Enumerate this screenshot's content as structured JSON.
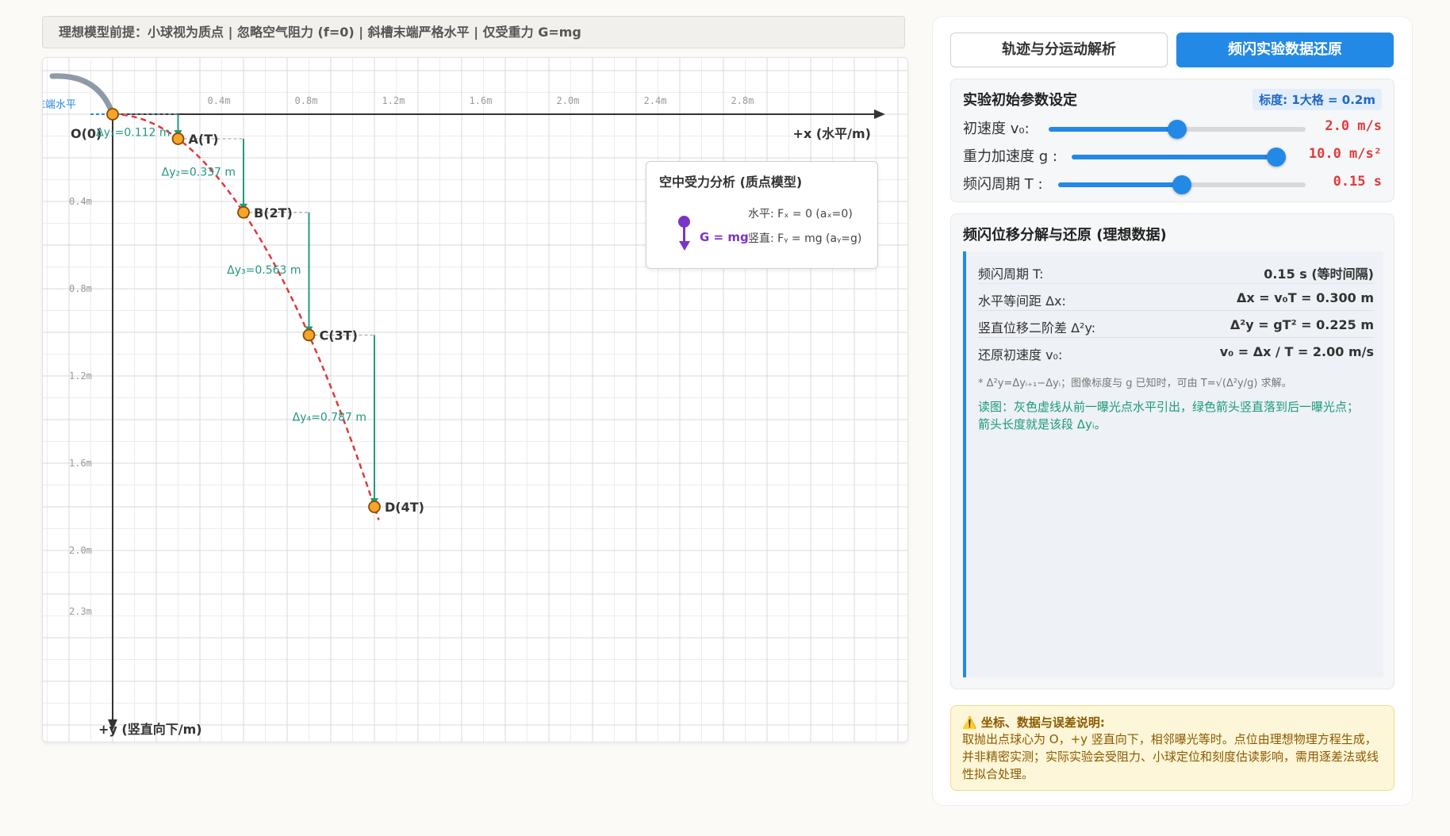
{
  "assumption": "理想模型前提：小球视为质点 | 忽略空气阻力 (f=0) | 斜槽末端严格水平 | 仅受重力 G=mg",
  "plot": {
    "ramp_label": "末端水平",
    "origin_label": "O(0)",
    "x_axis_label": "+x (水平/m)",
    "y_axis_label": "+y (竖直向下/m)",
    "x_ticks": [
      "0.4m",
      "0.8m",
      "1.2m",
      "1.6m",
      "2.0m",
      "2.4m",
      "2.8m"
    ],
    "x_tick_values": [
      0.4,
      0.8,
      1.2,
      1.6,
      2.0,
      2.4,
      2.8
    ],
    "y_ticks": [
      "0.4m",
      "0.8m",
      "1.2m",
      "1.6m",
      "2.0m",
      "2.3m"
    ],
    "y_tick_values": [
      0.4,
      0.8,
      1.2,
      1.6,
      2.0,
      2.28
    ],
    "points": [
      {
        "label": "A(T)",
        "x": 0.3,
        "y": 0.1125
      },
      {
        "label": "B(2T)",
        "x": 0.6,
        "y": 0.45
      },
      {
        "label": "C(3T)",
        "x": 0.9,
        "y": 1.0125
      },
      {
        "label": "D(4T)",
        "x": 1.2,
        "y": 1.8
      }
    ],
    "dy_labels": [
      "Δy₁=0.112 m",
      "Δy₂=0.337 m",
      "Δy₃=0.563 m",
      "Δy₄=0.787 m"
    ]
  },
  "force": {
    "title": "空中受力分析 (质点模型)",
    "horizontal": "水平: Fₓ = 0 (aₓ=0)",
    "gravity": "G = mg",
    "vertical": "竖直: Fᵧ = mg (aᵧ=g)"
  },
  "tabs": {
    "trajectory": "轨迹与分运动解析",
    "flash": "频闪实验数据还原"
  },
  "params": {
    "title": "实验初始参数设定",
    "scale": "标度: 1大格 = 0.2m",
    "v0_label": "初速度 v₀:",
    "v0_value": "2.0 m/s",
    "v0_fraction": 0.5,
    "g_label": "重力加速度 g :",
    "g_value": "10.0 m/s²",
    "g_fraction": 1.0,
    "T_label": "频闪周期 T :",
    "T_value": "0.15 s",
    "T_fraction": 0.5
  },
  "decomp": {
    "title": "频闪位移分解与还原 (理想数据)",
    "rows": [
      {
        "label": "频闪周期 T:",
        "value": "0.15 s (等时间隔)"
      },
      {
        "label": "水平等间距 Δx:",
        "value": "Δx = v₀T = 0.300 m"
      },
      {
        "label": "竖直位移二阶差 Δ²y:",
        "value": "Δ²y = gT² = 0.225 m"
      },
      {
        "label": "还原初速度 v₀:",
        "value": "v₀ = Δx / T = 2.00 m/s"
      }
    ],
    "note1": "* Δ²y=Δyᵢ₊₁−Δyᵢ；图像标度与 g 已知时，可由 T=√(Δ²y/g) 求解。",
    "note2": "读图：灰色虚线从前一曝光点水平引出，绿色箭头竖直落到后一曝光点；箭头长度就是该段 Δyᵢ。"
  },
  "warning": {
    "title": "⚠️ 坐标、数据与误差说明:",
    "text": "取抛出点球心为 O，+y 竖直向下，相邻曝光等时。点位由理想物理方程生成，并非精密实测；实际实验会受阻力、小球定位和刻度估读影响，需用逐差法或线性拟合处理。"
  }
}
